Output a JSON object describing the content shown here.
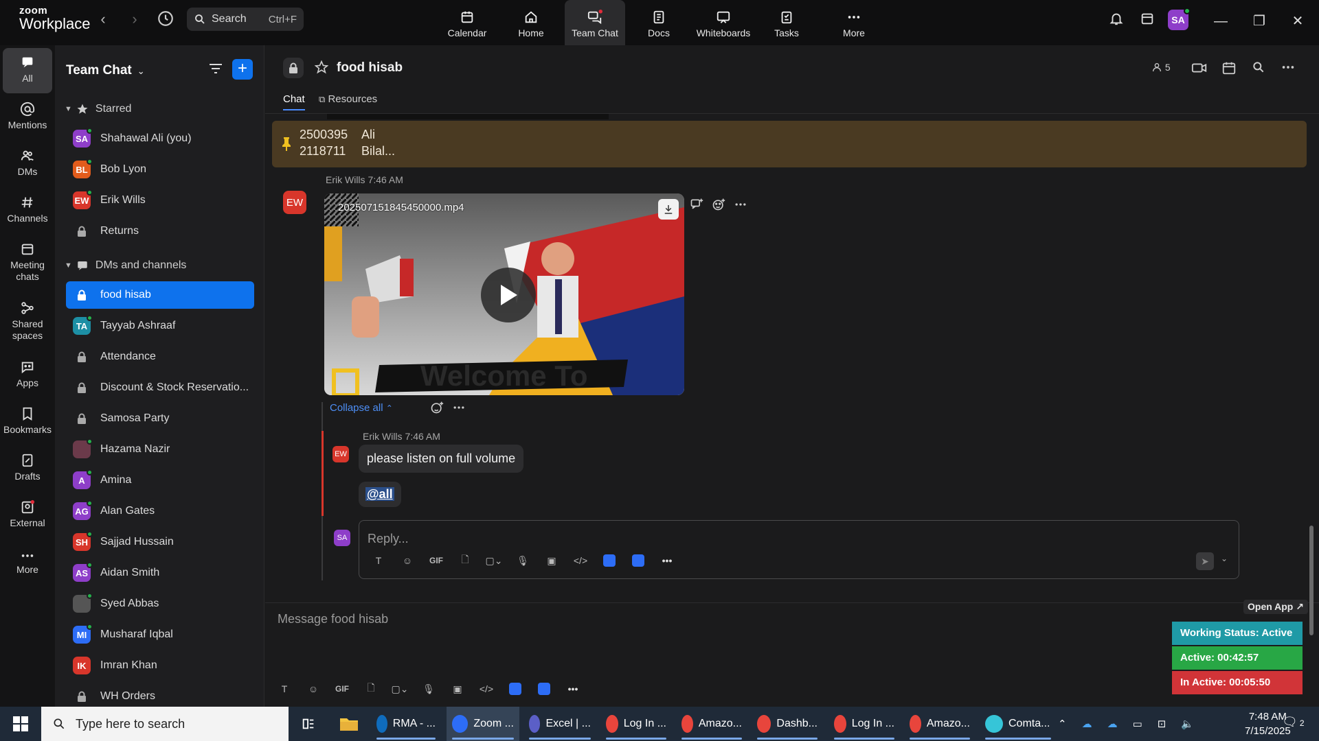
{
  "app": {
    "logo_line1": "zoom",
    "logo_line2": "Workplace"
  },
  "search": {
    "label": "Search",
    "shortcut": "Ctrl+F"
  },
  "topnav": [
    {
      "label": "Calendar",
      "icon": "calendar-icon"
    },
    {
      "label": "Home",
      "icon": "home-icon"
    },
    {
      "label": "Team Chat",
      "icon": "chat-icon",
      "active": true
    },
    {
      "label": "Docs",
      "icon": "docs-icon"
    },
    {
      "label": "Whiteboards",
      "icon": "whiteboard-icon"
    },
    {
      "label": "Tasks",
      "icon": "tasks-icon"
    },
    {
      "label": "More",
      "icon": "more-icon"
    }
  ],
  "user_avatar": "SA",
  "rail": [
    {
      "label": "All"
    },
    {
      "label": "Mentions"
    },
    {
      "label": "DMs"
    },
    {
      "label": "Channels"
    },
    {
      "label": "Meeting chats"
    },
    {
      "label": "Shared spaces"
    },
    {
      "label": "Apps"
    },
    {
      "label": "Bookmarks"
    },
    {
      "label": "Drafts"
    },
    {
      "label": "External"
    },
    {
      "label": "More"
    }
  ],
  "sidebar": {
    "title": "Team Chat",
    "starred_label": "Starred",
    "starred": [
      {
        "name": "Shahawal Ali (you)",
        "initials": "SA",
        "color": "#8e3ec9",
        "online": true
      },
      {
        "name": "Bob Lyon",
        "initials": "BL",
        "color": "#e25c1c",
        "online": true
      },
      {
        "name": "Erik Wills",
        "initials": "EW",
        "color": "#d8362b",
        "online": true
      },
      {
        "name": "Returns",
        "lock": true
      }
    ],
    "dms_label": "DMs and channels",
    "dms": [
      {
        "name": "food hisab",
        "lock": true,
        "active": true
      },
      {
        "name": "Tayyab Ashraaf",
        "initials": "TA",
        "color": "#1d8fa5",
        "online": true
      },
      {
        "name": "Attendance",
        "lock": true
      },
      {
        "name": "Discount & Stock Reservatio...",
        "lock": true
      },
      {
        "name": "Samosa Party",
        "lock": true
      },
      {
        "name": "Hazama Nazir",
        "initials": "",
        "color": "#6b3a4a",
        "online": true
      },
      {
        "name": "Amina",
        "initials": "A",
        "color": "#8e3ec9",
        "online": true
      },
      {
        "name": "Alan Gates",
        "initials": "AG",
        "color": "#8e3ec9",
        "online": true
      },
      {
        "name": "Sajjad Hussain",
        "initials": "SH",
        "color": "#d8362b",
        "online": true
      },
      {
        "name": "Aidan Smith",
        "initials": "AS",
        "color": "#8e3ec9",
        "online": true
      },
      {
        "name": "Syed Abbas",
        "initials": "",
        "color": "#555555",
        "online": true
      },
      {
        "name": "Musharaf Iqbal",
        "initials": "MI",
        "color": "#2d6df6",
        "online": true
      },
      {
        "name": "Imran Khan",
        "initials": "IK",
        "color": "#d8362b",
        "online": false
      },
      {
        "name": "WH Orders",
        "lock": true
      }
    ]
  },
  "channel": {
    "name": "food hisab",
    "tabs": [
      "Chat",
      "Resources"
    ],
    "member_count": "5"
  },
  "pinned": {
    "rows": [
      {
        "num": "2500395",
        "name": "Ali"
      },
      {
        "num": "2118711",
        "name": "Bilal..."
      }
    ]
  },
  "messages": {
    "video_sender": "Erik Wills",
    "video_time": "7:46 AM",
    "video_initials": "EW",
    "video_filename": "20250715184545000​0.mp4",
    "collapse_label": "Collapse all",
    "reply_sender": "Erik Wills",
    "reply_time": "7:46 AM",
    "reply_initials": "EW",
    "reply_text": "please listen on full volume",
    "mention_text": "@all",
    "my_initials": "SA",
    "reply_placeholder": "Reply...",
    "compose_placeholder": "Message food hisab"
  },
  "status_widget": {
    "open_app": "Open App ↗",
    "working": "Working Status: Active",
    "active": "Active: 00:42:57",
    "inactive": "In Active: 00:05:50",
    "colors": {
      "working": "#1f9aa6",
      "active": "#28a745",
      "inactive": "#d13438"
    }
  },
  "taskbar": {
    "search_placeholder": "Type here to search",
    "apps": [
      {
        "label": "RMA - ...",
        "color": "#0f6cbd"
      },
      {
        "label": "Zoom ...",
        "color": "#2d6df6",
        "active": true
      },
      {
        "label": "Excel | ...",
        "color": "#5b5fc7"
      },
      {
        "label": "Log In ...",
        "color": "#e8453c"
      },
      {
        "label": "Amazo...",
        "color": "#e8453c"
      },
      {
        "label": "Dashb...",
        "color": "#e8453c"
      },
      {
        "label": "Log In ...",
        "color": "#e8453c"
      },
      {
        "label": "Amazo...",
        "color": "#e8453c"
      },
      {
        "label": "Comta...",
        "color": "#36c5d8"
      }
    ],
    "time": "7:48 AM",
    "date": "7/15/2025",
    "notif_count": "2"
  }
}
